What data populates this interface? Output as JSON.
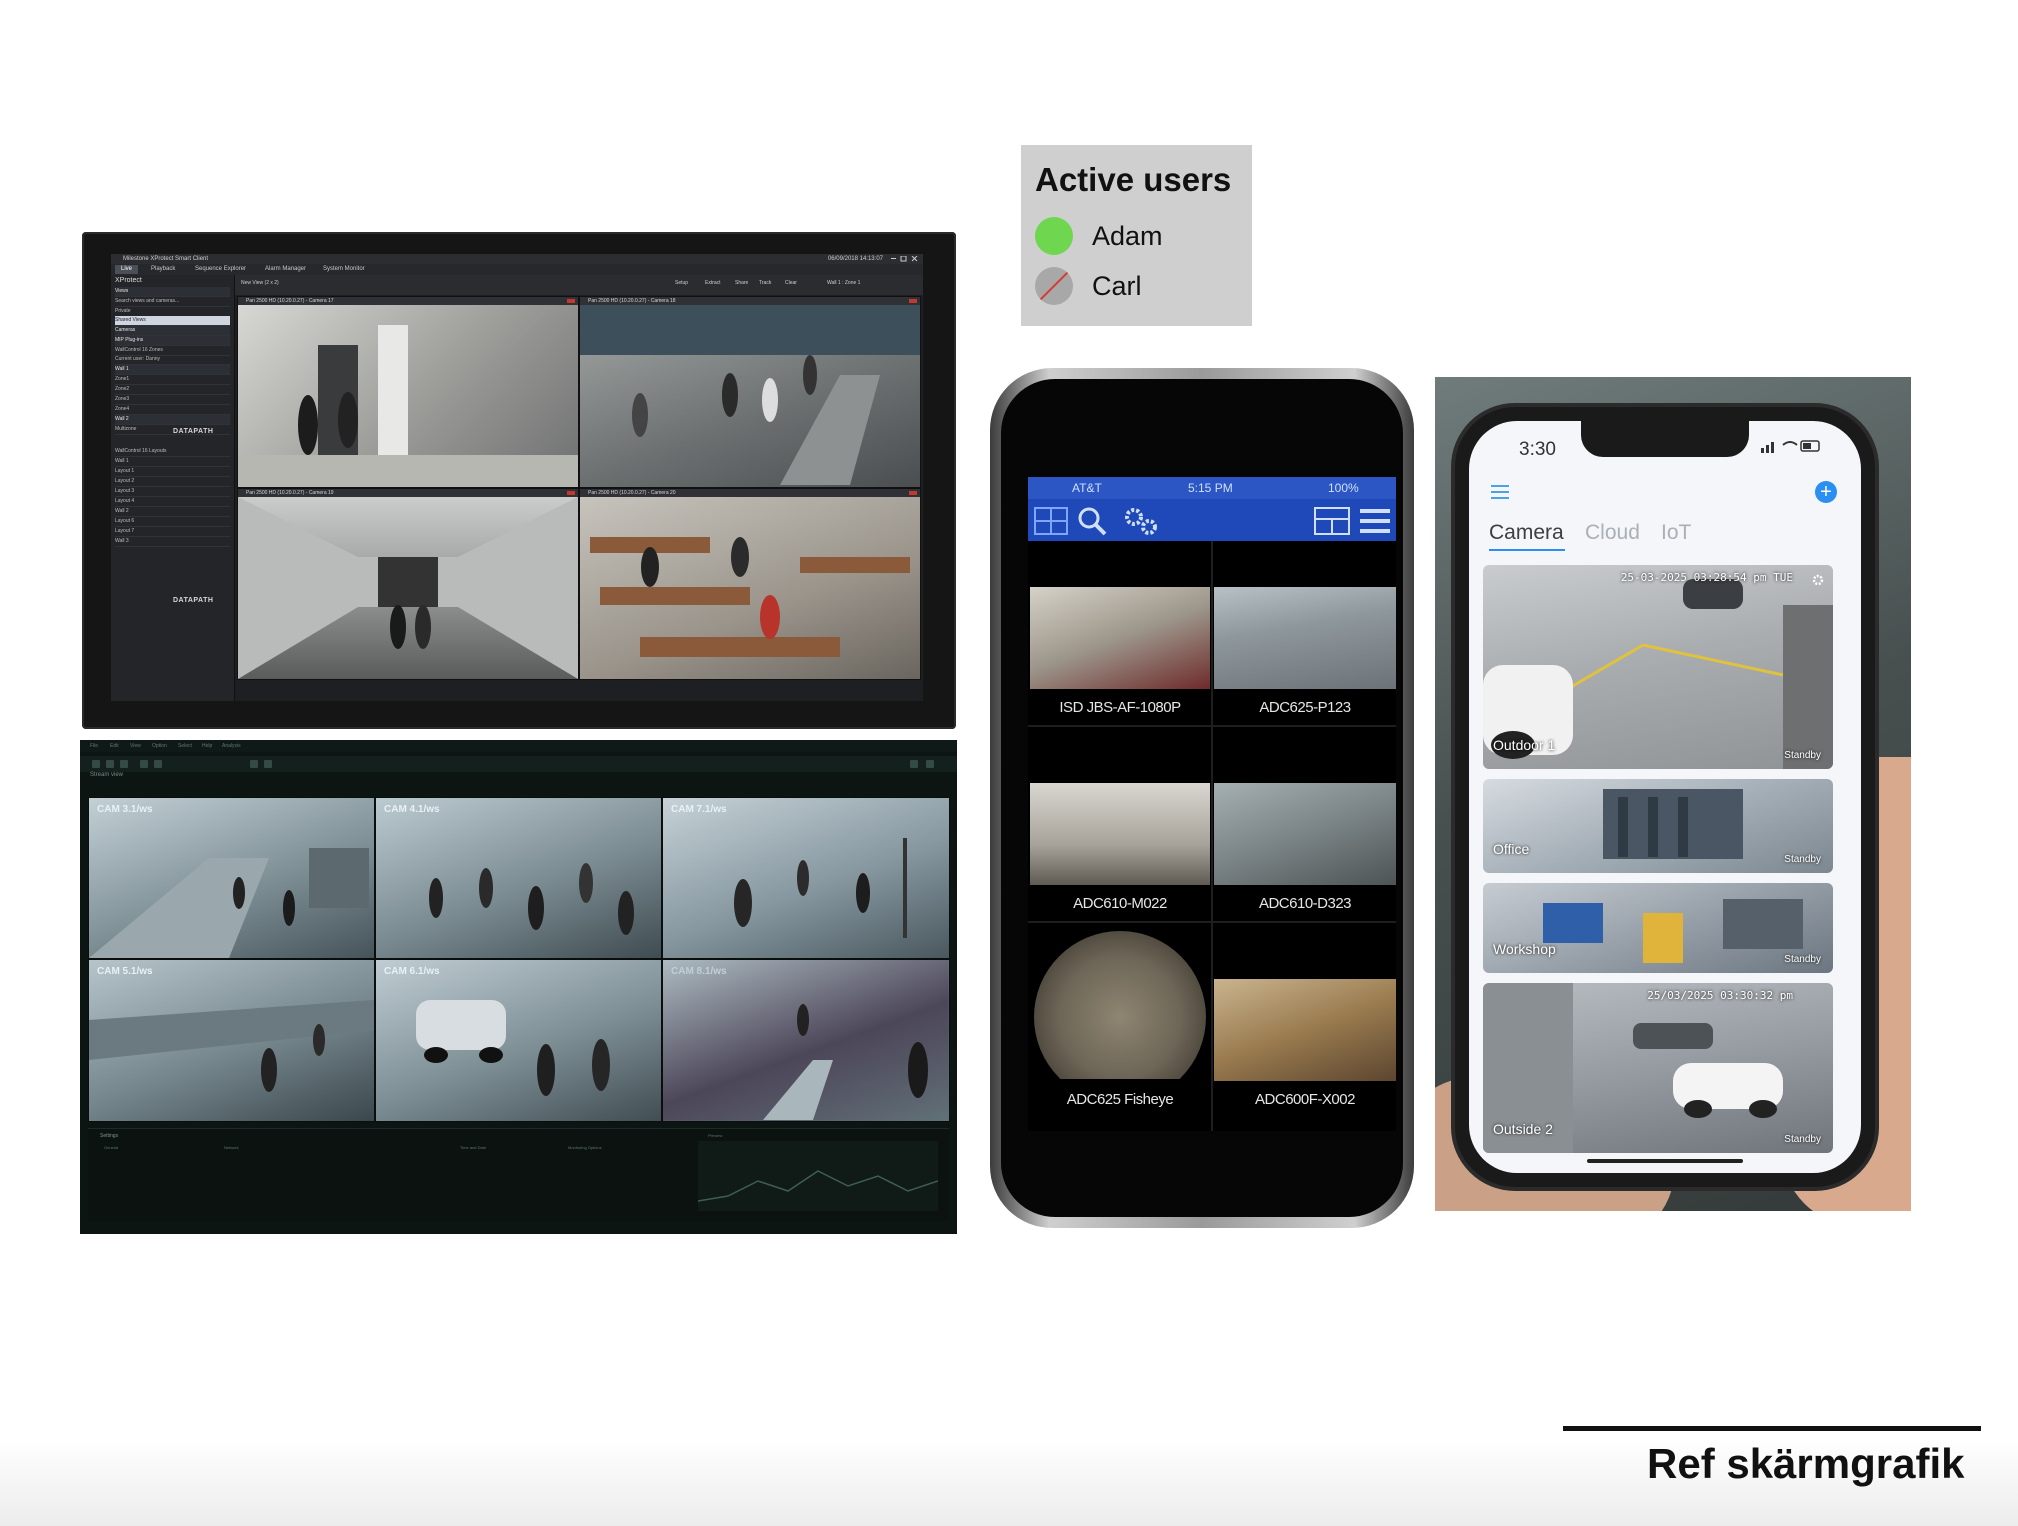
{
  "legend": {
    "title": "Active users",
    "users": [
      {
        "name": "Adam",
        "status": "online",
        "color": "#6fd650"
      },
      {
        "name": "Carl",
        "status": "offline",
        "color": "#a8a8a8"
      }
    ]
  },
  "monitor1": {
    "app_title": "Milestone XProtect Smart Client",
    "datetime": "06/09/2018 14:13:07",
    "tabs": [
      "Live",
      "Playback",
      "Sequence Explorer",
      "Alarm Manager",
      "System Monitor"
    ],
    "sidebar_title": "XProtect",
    "sidebar_items": [
      "Views",
      "Search views and cameras...",
      "Private",
      "Shared Views",
      "Cameras",
      "MIP Plug-ins",
      "WallControl 16 Zones",
      "Current user: Danny",
      "Wall 1",
      "Zone1",
      "Zone2",
      "Zone3",
      "Zone4",
      "Wall 2",
      "Multizone"
    ],
    "sidebar_items2": [
      "WallControl 16 Layouts",
      "Wall 1",
      "Layout 1",
      "Layout 2",
      "Layout 3",
      "Layout 4",
      "Wall 2",
      "Layout 6",
      "Layout 7",
      "Wall 3"
    ],
    "brand": "DATAPATH",
    "toolbar": [
      "Setup",
      "Extract",
      "Share",
      "Track",
      "Clear",
      "Wall 1 : Zone 1"
    ],
    "view_select": "New View (2 x 2)",
    "cameras": [
      "Pan 2500 HD (10.20.0.27) - Camera 17",
      "Pan 2500 HD (10.20.0.27) - Camera 18",
      "Pan 2500 HD (10.20.0.27) - Camera 19",
      "Pan 2500 HD (10.20.0.27) - Camera 20"
    ]
  },
  "monitor2": {
    "menu": [
      "File",
      "Edit",
      "View",
      "Option",
      "Select",
      "Help",
      "Analysis"
    ],
    "stream_label": "Stream view",
    "cameras": [
      "CAM 3.1/ws",
      "CAM 4.1/ws",
      "CAM 7.1/ws",
      "CAM 5.1/ws",
      "CAM 6.1/ws",
      "CAM 8.1/ws"
    ],
    "settings": "Settings",
    "sections": [
      "General",
      "Network",
      "Time and Date",
      "Monitoring Options",
      "Preview"
    ]
  },
  "phone1": {
    "carrier": "AT&T",
    "time": "5:15 PM",
    "battery": "100%",
    "cameras": [
      "ISD JBS-AF-1080P",
      "ADC625-P123",
      "ADC610-M022",
      "ADC610-D323",
      "ADC625 Fisheye",
      "ADC600F-X002"
    ]
  },
  "phone2": {
    "time": "3:30",
    "tabs": [
      "Camera",
      "Cloud",
      "IoT"
    ],
    "cameras": [
      {
        "name": "Outdoor 1",
        "status": "Standby",
        "date": "25-03-2025 03:28:54 pm TUE"
      },
      {
        "name": "Office",
        "status": "Standby",
        "date": ""
      },
      {
        "name": "Workshop",
        "status": "Standby",
        "date": ""
      },
      {
        "name": "Outside 2",
        "status": "Standby",
        "date": "25/03/2025 03:30:32 pm"
      }
    ]
  },
  "footer": {
    "title": "Ref skärmgrafik"
  }
}
